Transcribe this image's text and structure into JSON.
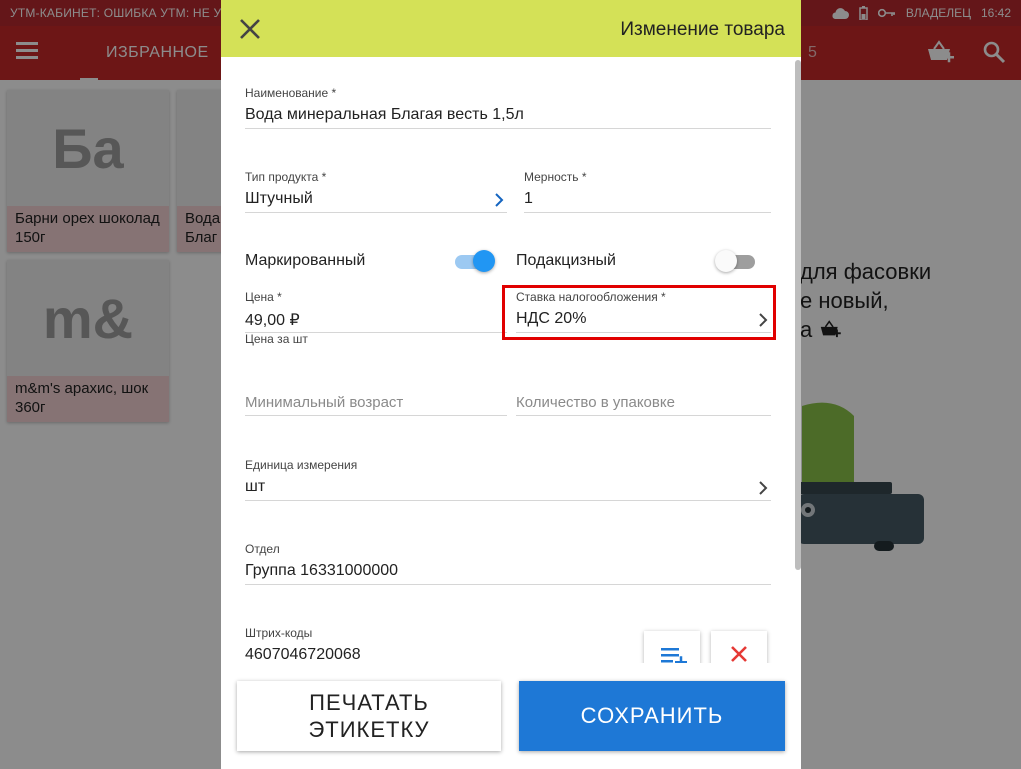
{
  "statusbar": {
    "message": "УТМ-КАБИНЕТ: ОШИБКА УТМ: НЕ УК",
    "user": "ВЛАДЕЛЕЦ",
    "time": "16:42"
  },
  "appbar": {
    "tab_favorites": "ИЗБРАННОЕ",
    "tab_number": "5"
  },
  "products": [
    {
      "glyph": "Ба",
      "name": "Барни орех шоколад 150г"
    },
    {
      "glyph": "",
      "name": "Вода Благ"
    },
    {
      "glyph": "m&",
      "name": "m&m's арахис, шок 360г"
    }
  ],
  "background_message": {
    "line1": "для фасовки",
    "line2": "е новый,",
    "line3": "а"
  },
  "dialog": {
    "title": "Изменение товара",
    "fields": {
      "name": {
        "label": "Наименование *",
        "value": "Вода минеральная Благая весть 1,5л"
      },
      "product_type": {
        "label": "Тип продукта *",
        "value": "Штучный"
      },
      "dimension": {
        "label": "Мерность *",
        "value": "1"
      },
      "marked": {
        "label": "Маркированный",
        "on": true
      },
      "excise": {
        "label": "Подакцизный",
        "on": false
      },
      "price": {
        "label": "Цена *",
        "value": "49,00 ₽",
        "hint": "Цена за шт"
      },
      "tax_rate": {
        "label": "Ставка налогообложения *",
        "value": "НДС 20%"
      },
      "min_age": {
        "placeholder": "Минимальный возраст"
      },
      "pack_qty": {
        "placeholder": "Количество в упаковке"
      },
      "unit": {
        "label": "Единица измерения",
        "value": "шт"
      },
      "department": {
        "label": "Отдел",
        "value": "Группа 16331000000"
      },
      "barcodes": {
        "label": "Штрих-коды",
        "value": "4607046720068"
      }
    },
    "buttons": {
      "print_line1": "ПЕЧАТАТЬ",
      "print_line2": "ЭТИКЕТКУ",
      "save": "СОХРАНИТЬ"
    }
  },
  "colors": {
    "header_green": "#d4e157",
    "save_blue": "#1e78d6",
    "toggle_on": "#2196f3",
    "highlight_red": "#e10000",
    "appbar_red": "#c62828"
  }
}
